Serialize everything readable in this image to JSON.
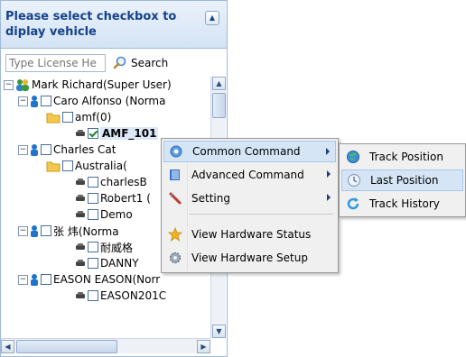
{
  "panel": {
    "title": "Please select checkbox to diplay vehicle",
    "collapse_glyph": "▲"
  },
  "search": {
    "placeholder": "Type License He",
    "button_label": "Search"
  },
  "tree": {
    "root": "Mark Richard(Super User)",
    "n1": "Caro Alfonso (Norma",
    "n2": "amf(0)",
    "n3": "AMF_101",
    "n4": "Charles Cat",
    "n5": "Australia(",
    "n6": "charlesB",
    "n7": "Robert1 (",
    "n8": "Demo",
    "n9": "张 炜(Norma",
    "n10": "耐威格",
    "n11": "DANNY",
    "n12": "EASON EASON(Norr",
    "n13": "EASON201C"
  },
  "context_menu": {
    "common": "Common Command",
    "advanced": "Advanced Command",
    "setting": "Setting",
    "hw_status": "View Hardware Status",
    "hw_setup": "View Hardware Setup"
  },
  "submenu": {
    "track_position": "Track Position",
    "last_position": "Last Position",
    "track_history": "Track History"
  },
  "colors": {
    "header_text": "#15428b",
    "menu_highlight": "#d5e5f6",
    "user_icon": "#1f74c9",
    "folder": "#f2c94c",
    "car": "#444444"
  }
}
